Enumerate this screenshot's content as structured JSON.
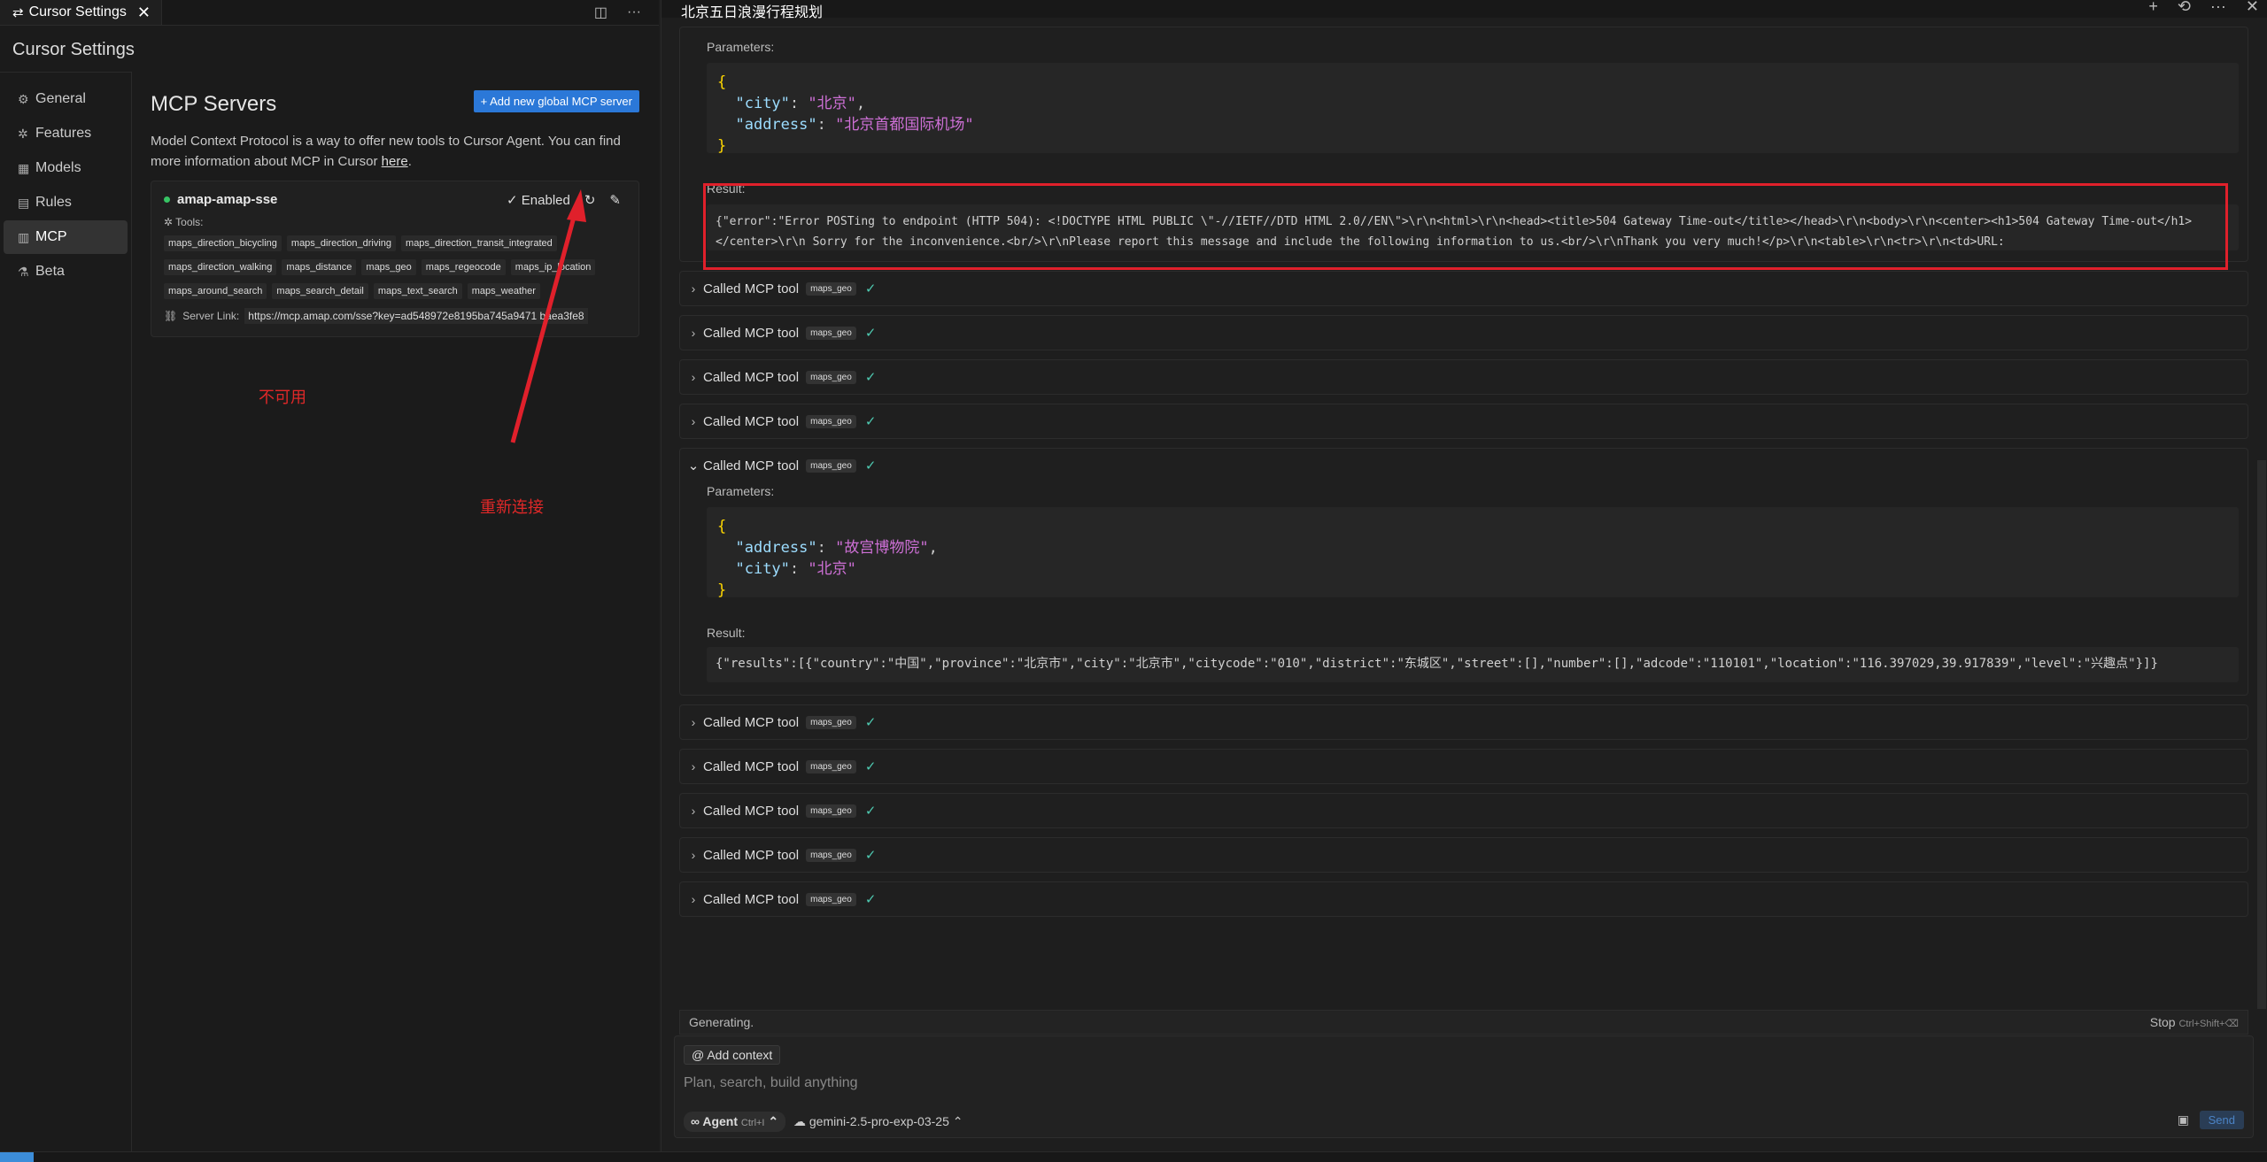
{
  "left_tab": {
    "title": "Cursor Settings",
    "close": "✕"
  },
  "settings": {
    "title": "Cursor Settings",
    "nav": [
      {
        "icon": "⚙",
        "label": "General"
      },
      {
        "icon": "✲",
        "label": "Features"
      },
      {
        "icon": "▦",
        "label": "Models"
      },
      {
        "icon": "▤",
        "label": "Rules"
      },
      {
        "icon": "▥",
        "label": "MCP"
      },
      {
        "icon": "⚗",
        "label": "Beta"
      }
    ],
    "mcp": {
      "title": "MCP Servers",
      "add_button": "+ Add new global MCP server",
      "description": "Model Context Protocol is a way to offer new tools to Cursor Agent. You can find more information about MCP in Cursor ",
      "link": "here",
      "period": ".",
      "server": {
        "name": "amap-amap-sse",
        "status": "✓ Enabled",
        "tools_label": "Tools:",
        "tools": [
          "maps_direction_bicycling",
          "maps_direction_driving",
          "maps_direction_transit_integrated",
          "maps_direction_walking",
          "maps_distance",
          "maps_geo",
          "maps_regeocode",
          "maps_ip_location",
          "maps_around_search",
          "maps_search_detail",
          "maps_text_search",
          "maps_weather"
        ],
        "link_label": "Server Link:",
        "url": "https://mcp.amap.com/sse?key=ad548972e8195ba745a9471 baea3fe8"
      }
    },
    "annotations": {
      "unavailable": "不可用",
      "reconnect": "重新连接"
    }
  },
  "chat": {
    "title": "北京五日浪漫行程规划",
    "params_label": "Parameters:",
    "result_label": "Result:",
    "call_label": "Called MCP tool",
    "tool_badge": "maps_geo",
    "block1": {
      "key1": "\"city\"",
      "val1": "\"北京\"",
      "key2": "\"address\"",
      "val2": "\"北京首都国际机场\""
    },
    "error_result": "{\"error\":\"Error POSTing to endpoint (HTTP 504): <!DOCTYPE HTML PUBLIC \\\"-//IETF//DTD HTML 2.0//EN\\\">\\r\\n<html>\\r\\n<head><title>504 Gateway Time-out</title></head>\\r\\n<body>\\r\\n<center><h1>504 Gateway Time-out</h1></center>\\r\\n Sorry for the inconvenience.<br/>\\r\\nPlease report this message and include the following information to us.<br/>\\r\\nThank you very much!</p>\\r\\n<table>\\r\\n<tr>\\r\\n<td>URL:",
    "block2": {
      "key1": "\"address\"",
      "val1": "\"故宫博物院\"",
      "key2": "\"city\"",
      "val2": "\"北京\""
    },
    "block2_result": "{\"results\":[{\"country\":\"中国\",\"province\":\"北京市\",\"city\":\"北京市\",\"citycode\":\"010\",\"district\":\"东城区\",\"street\":[],\"number\":[],\"adcode\":\"110101\",\"location\":\"116.397029,39.917839\",\"level\":\"兴趣点\"}]}",
    "generating": "Generating.",
    "stop": "Stop",
    "stop_shortcut": "Ctrl+Shift+⌫",
    "add_context": "Add context",
    "input_placeholder": "Plan, search, build anything",
    "agent": "∞ Agent",
    "agent_shortcut": "Ctrl+I",
    "model": "gemini-2.5-pro-exp-03-25",
    "send": "Send"
  }
}
